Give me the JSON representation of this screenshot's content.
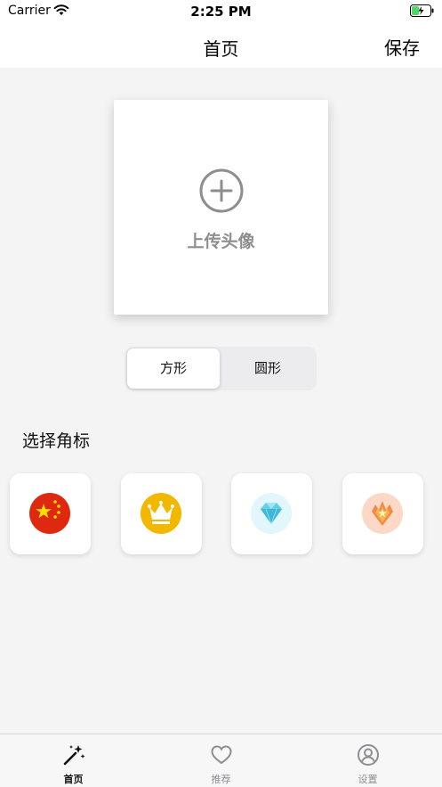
{
  "status_bar": {
    "carrier": "Carrier",
    "time": "2:25 PM",
    "icons": [
      "wifi-icon",
      "battery-charging-icon"
    ]
  },
  "nav": {
    "title": "首页",
    "save_label": "保存"
  },
  "upload": {
    "label": "上传头像",
    "icon": "plus-circle-icon"
  },
  "shape_selector": {
    "options": [
      "方形",
      "圆形"
    ],
    "selected": "方形"
  },
  "badges": {
    "title": "选择角标",
    "items": [
      {
        "icon": "china-flag-icon"
      },
      {
        "icon": "crown-icon"
      },
      {
        "icon": "diamond-icon"
      },
      {
        "icon": "phoenix-icon"
      }
    ]
  },
  "tab_bar": {
    "items": [
      {
        "label": "首页",
        "icon": "magic-wand-icon",
        "active": true
      },
      {
        "label": "推荐",
        "icon": "heart-icon",
        "active": false
      },
      {
        "label": "设置",
        "icon": "user-circle-icon",
        "active": false
      }
    ]
  },
  "colors": {
    "background": "#f4f4f5",
    "card": "#ffffff",
    "muted_text": "#8e8e8e",
    "battery_green": "#4cd964",
    "flag_red": "#de2910",
    "flag_yellow": "#ffde00",
    "crown_gold": "#f2b800",
    "diamond_cyan": "#62d1e8",
    "phoenix_orange": "#f08a4b"
  }
}
